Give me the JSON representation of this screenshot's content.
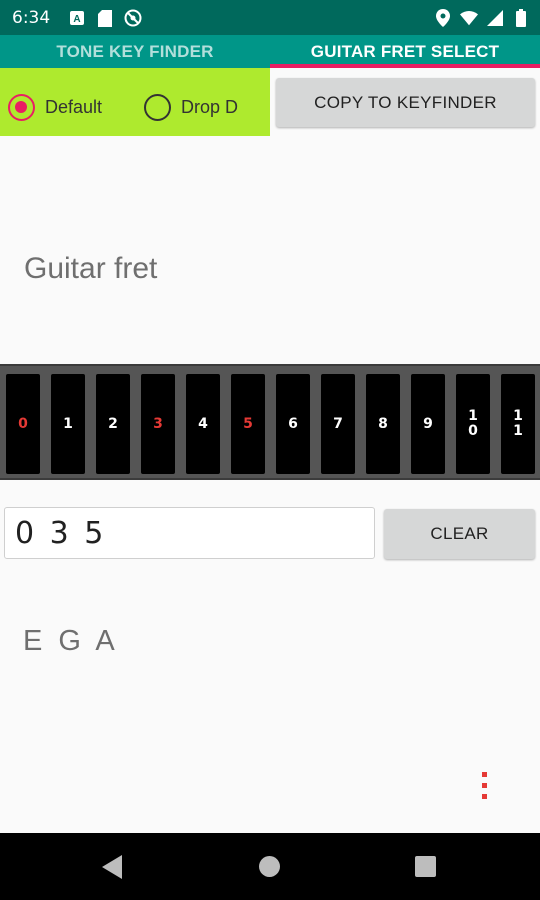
{
  "status_bar": {
    "time": "6:34",
    "icons": [
      "a-icon",
      "sd-card-icon",
      "do-not-disturb-icon",
      "location-icon",
      "wifi-icon",
      "signal-icon",
      "battery-icon"
    ]
  },
  "tabs": [
    {
      "label": "TONE KEY FINDER",
      "selected": false
    },
    {
      "label": "GUITAR FRET SELECT",
      "selected": true
    }
  ],
  "tuning": {
    "options": [
      {
        "label": "Default",
        "checked": true
      },
      {
        "label": "Drop D",
        "checked": false
      }
    ]
  },
  "buttons": {
    "copy_label": "COPY TO KEYFINDER",
    "clear_label": "CLEAR"
  },
  "section_title": "Guitar fret",
  "frets": [
    {
      "label": "0",
      "selected": true
    },
    {
      "label": "1",
      "selected": false
    },
    {
      "label": "2",
      "selected": false
    },
    {
      "label": "3",
      "selected": true
    },
    {
      "label": "4",
      "selected": false
    },
    {
      "label": "5",
      "selected": true
    },
    {
      "label": "6",
      "selected": false
    },
    {
      "label": "7",
      "selected": false
    },
    {
      "label": "8",
      "selected": false
    },
    {
      "label": "9",
      "selected": false
    },
    {
      "label": "10",
      "selected": false
    },
    {
      "label": "11",
      "selected": false
    }
  ],
  "fret_input_value": "0 3 5",
  "result_notes": "E G A",
  "colors": {
    "accent": "#e91e63",
    "tab_bar": "#009688",
    "status_bar": "#00695c",
    "tuning_panel": "#aeea2e",
    "selected_fret_text": "#e53935"
  }
}
